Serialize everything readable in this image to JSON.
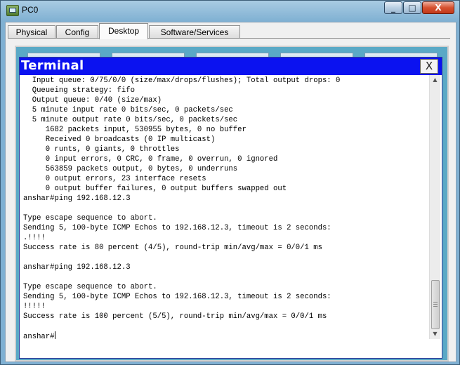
{
  "window": {
    "title": "PC0",
    "controls": {
      "minimize": "_",
      "maximize": "□",
      "close": "X"
    }
  },
  "tabs": [
    {
      "label": "Physical"
    },
    {
      "label": "Config"
    },
    {
      "label": "Desktop",
      "active": true
    },
    {
      "label": "Software/Services"
    }
  ],
  "terminal": {
    "title": "Terminal",
    "close_label": "X",
    "lines": [
      "  Input queue: 0/75/0/0 (size/max/drops/flushes); Total output drops: 0",
      "  Queueing strategy: fifo",
      "  Output queue: 0/40 (size/max)",
      "  5 minute input rate 0 bits/sec, 0 packets/sec",
      "  5 minute output rate 0 bits/sec, 0 packets/sec",
      "     1682 packets input, 530955 bytes, 0 no buffer",
      "     Received 0 broadcasts (0 IP multicast)",
      "     0 runts, 0 giants, 0 throttles",
      "     0 input errors, 0 CRC, 0 frame, 0 overrun, 0 ignored",
      "     563859 packets output, 0 bytes, 0 underruns",
      "     0 output errors, 23 interface resets",
      "     0 output buffer failures, 0 output buffers swapped out",
      "anshar#ping 192.168.12.3",
      "",
      "Type escape sequence to abort.",
      "Sending 5, 100-byte ICMP Echos to 192.168.12.3, timeout is 2 seconds:",
      ".!!!!",
      "Success rate is 80 percent (4/5), round-trip min/avg/max = 0/0/1 ms",
      "",
      "anshar#ping 192.168.12.3",
      "",
      "Type escape sequence to abort.",
      "Sending 5, 100-byte ICMP Echos to 192.168.12.3, timeout is 2 seconds:",
      "!!!!!",
      "Success rate is 100 percent (5/5), round-trip min/avg/max = 0/0/1 ms",
      ""
    ],
    "prompt": "anshar#"
  },
  "colors": {
    "terminal_header": "#0b12f0",
    "desktop_bg": "#5aa9c6",
    "window_frame": "#7fb0d2"
  }
}
